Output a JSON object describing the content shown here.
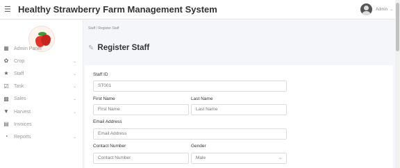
{
  "header": {
    "title": "Healthy Strawberry Farm Management System",
    "user_name": "Admin"
  },
  "sidebar": {
    "items": [
      {
        "label": "Admin Panel",
        "icon": "grid-icon",
        "has_arrow": false
      },
      {
        "label": "Crop",
        "icon": "seedling-icon",
        "has_arrow": true
      },
      {
        "label": "Staff",
        "icon": "users-icon",
        "has_arrow": true
      },
      {
        "label": "Task",
        "icon": "checkbox-icon",
        "has_arrow": true
      },
      {
        "label": "Sales",
        "icon": "sales-icon",
        "has_arrow": true
      },
      {
        "label": "Harvest",
        "icon": "harvest-icon",
        "has_arrow": true
      },
      {
        "label": "Invoices",
        "icon": "invoice-icon",
        "has_arrow": false
      },
      {
        "label": "Reports",
        "icon": "report-icon",
        "has_arrow": true
      }
    ]
  },
  "breadcrumb": {
    "parent": "Staff",
    "separator": "/",
    "current": "Register Staff"
  },
  "page": {
    "title": "Register Staff"
  },
  "form": {
    "staff_id": {
      "label": "Staff ID",
      "value": "ST001"
    },
    "first_name": {
      "label": "First Name",
      "placeholder": "First Name"
    },
    "last_name": {
      "label": "Last Name",
      "placeholder": "Last Name"
    },
    "email": {
      "label": "Email Address",
      "placeholder": "Email Address"
    },
    "contact": {
      "label": "Contact Number",
      "placeholder": "Contact Number"
    },
    "gender": {
      "label": "Gender",
      "value": "Male"
    }
  }
}
